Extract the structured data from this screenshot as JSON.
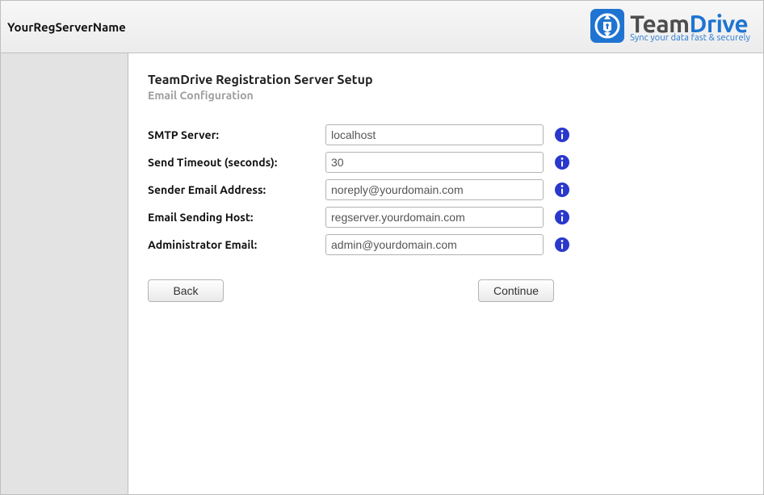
{
  "header": {
    "server_name": "YourRegServerName",
    "logo_team": "Team",
    "logo_drive": "Drive",
    "logo_tagline": "Sync your data fast & securely"
  },
  "page": {
    "title": "TeamDrive Registration Server Setup",
    "subtitle": "Email Configuration"
  },
  "form": {
    "smtp_server": {
      "label": "SMTP Server:",
      "value": "localhost"
    },
    "send_timeout": {
      "label": "Send Timeout (seconds):",
      "value": "30"
    },
    "sender_email": {
      "label": "Sender Email Address:",
      "value": "noreply@yourdomain.com"
    },
    "sending_host": {
      "label": "Email Sending Host:",
      "value": "regserver.yourdomain.com"
    },
    "admin_email": {
      "label": "Administrator Email:",
      "value": "admin@yourdomain.com"
    }
  },
  "buttons": {
    "back": "Back",
    "continue": "Continue"
  }
}
